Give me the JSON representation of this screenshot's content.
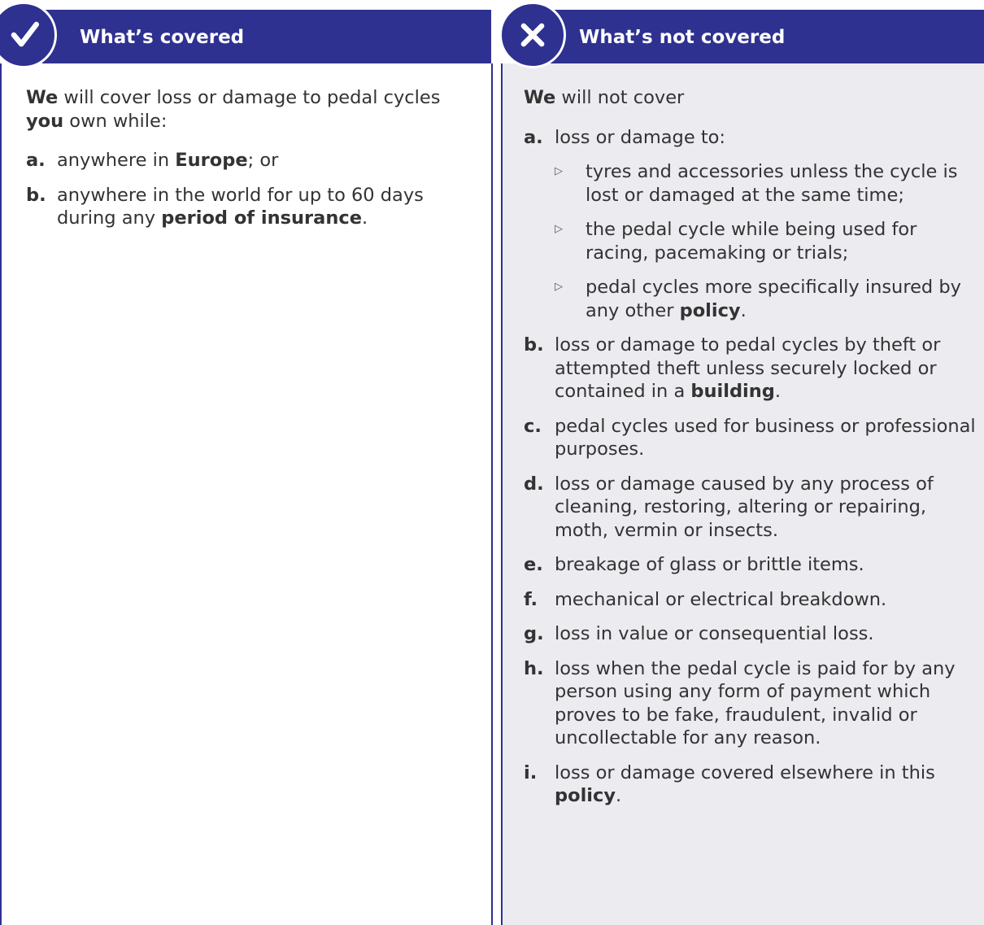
{
  "covered": {
    "title": "What’s covered",
    "intro": [
      {
        "b": "We"
      },
      {
        "t": " will cover loss or damage to pedal cycles "
      },
      {
        "b": "you"
      },
      {
        "t": " own while:"
      }
    ],
    "items": [
      {
        "label": "a.",
        "parts": [
          {
            "t": "anywhere in "
          },
          {
            "b": "Europe"
          },
          {
            "t": "; or"
          }
        ]
      },
      {
        "label": "b.",
        "parts": [
          {
            "t": "anywhere in the world for up to 60 days during any "
          },
          {
            "b": "period of insurance"
          },
          {
            "t": "."
          }
        ]
      }
    ]
  },
  "not_covered": {
    "title": "What’s not covered",
    "intro": [
      {
        "b": "We"
      },
      {
        "t": " will not cover"
      }
    ],
    "items": [
      {
        "label": "a.",
        "parts": [
          {
            "t": "loss or damage to:"
          }
        ],
        "subitems": [
          [
            {
              "t": "tyres and accessories unless the cycle is lost or damaged at the same time;"
            }
          ],
          [
            {
              "t": "the pedal cycle while being used for racing, pacemaking or trials;"
            }
          ],
          [
            {
              "t": "pedal cycles more specifically insured by any other "
            },
            {
              "b": "policy"
            },
            {
              "t": "."
            }
          ]
        ]
      },
      {
        "label": "b.",
        "parts": [
          {
            "t": "loss or damage to pedal cycles by theft or attempted theft unless securely locked or contained in a "
          },
          {
            "b": "building"
          },
          {
            "t": "."
          }
        ]
      },
      {
        "label": "c.",
        "parts": [
          {
            "t": "pedal cycles used for business or professional purposes."
          }
        ]
      },
      {
        "label": "d.",
        "parts": [
          {
            "t": "loss or damage caused by any process of cleaning, restoring, altering or repairing, moth, vermin or insects."
          }
        ]
      },
      {
        "label": "e.",
        "parts": [
          {
            "t": "breakage of glass or brittle items."
          }
        ]
      },
      {
        "label": "f.",
        "parts": [
          {
            "t": "mechanical or electrical breakdown."
          }
        ]
      },
      {
        "label": "g.",
        "parts": [
          {
            "t": "loss in value or consequential loss."
          }
        ]
      },
      {
        "label": "h.",
        "parts": [
          {
            "t": "loss when the pedal cycle is paid for by any person using any form of payment which proves to be fake, fraudulent, invalid or uncollectable for any reason."
          }
        ]
      },
      {
        "label": "i.",
        "parts": [
          {
            "t": "loss or damage covered elsewhere in this "
          },
          {
            "b": "policy"
          },
          {
            "t": "."
          }
        ]
      }
    ]
  },
  "icons": {
    "covered": "check-icon",
    "not_covered": "cross-icon",
    "bullet": "triangle-bullet-icon"
  },
  "colors": {
    "brand": "#2e3190",
    "panel_grey": "#ecebf0",
    "text": "#333333"
  }
}
